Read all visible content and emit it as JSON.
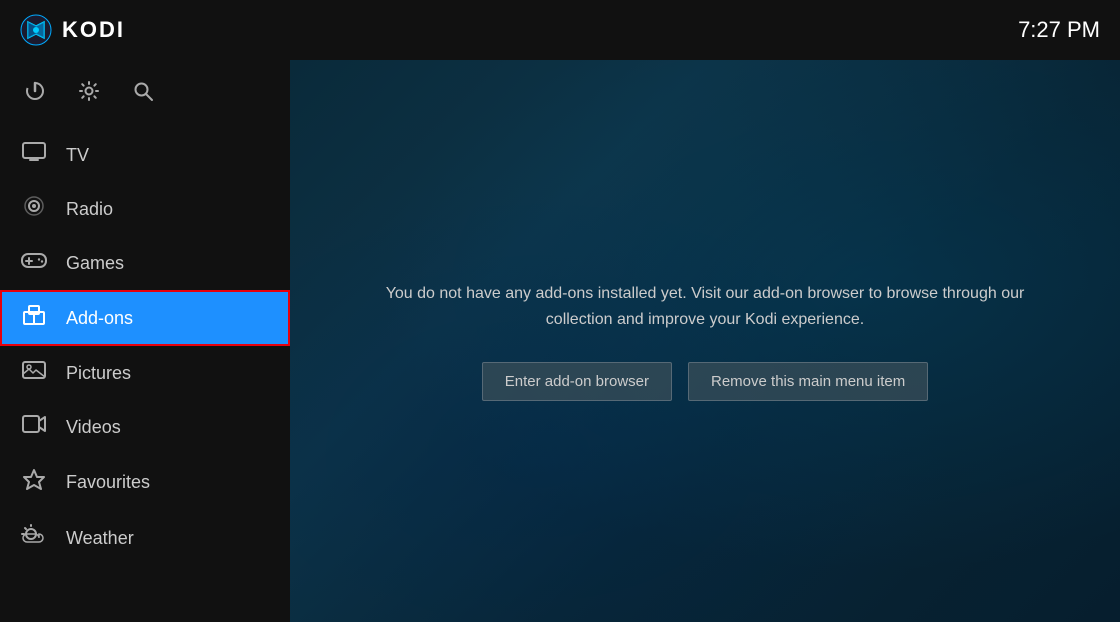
{
  "topbar": {
    "title": "KODI",
    "clock": "7:27 PM"
  },
  "sidebar": {
    "icons": [
      {
        "name": "power-icon",
        "symbol": "⏻",
        "label": "Power"
      },
      {
        "name": "settings-icon",
        "symbol": "⚙",
        "label": "Settings"
      },
      {
        "name": "search-icon",
        "symbol": "🔍",
        "label": "Search"
      }
    ],
    "nav_items": [
      {
        "id": "tv",
        "label": "TV",
        "icon": "📺",
        "active": false
      },
      {
        "id": "radio",
        "label": "Radio",
        "icon": "📻",
        "active": false
      },
      {
        "id": "games",
        "label": "Games",
        "icon": "🎮",
        "active": false
      },
      {
        "id": "addons",
        "label": "Add-ons",
        "icon": "📦",
        "active": true
      },
      {
        "id": "pictures",
        "label": "Pictures",
        "icon": "🖼",
        "active": false
      },
      {
        "id": "videos",
        "label": "Videos",
        "icon": "🎬",
        "active": false
      },
      {
        "id": "favourites",
        "label": "Favourites",
        "icon": "⭐",
        "active": false
      },
      {
        "id": "weather",
        "label": "Weather",
        "icon": "🌤",
        "active": false
      }
    ]
  },
  "content": {
    "message": "You do not have any add-ons installed yet. Visit our add-on browser to browse through our collection and improve your Kodi experience.",
    "buttons": [
      {
        "id": "enter-addon-browser",
        "label": "Enter add-on browser"
      },
      {
        "id": "remove-menu-item",
        "label": "Remove this main menu item"
      }
    ]
  }
}
